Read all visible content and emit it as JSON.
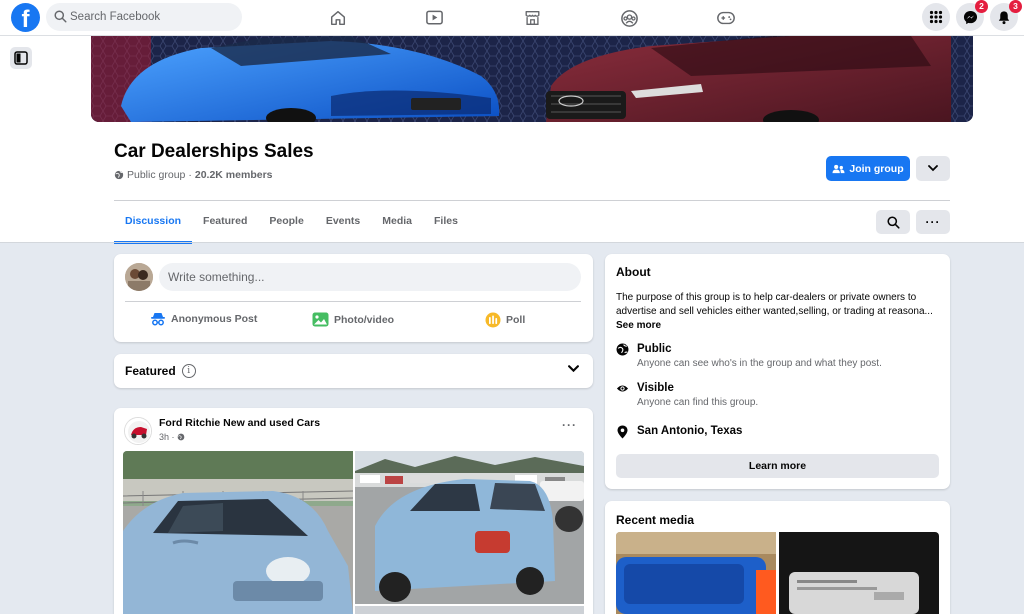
{
  "topbar": {
    "logo": "f",
    "search_placeholder": "Search Facebook",
    "nav_icons": [
      "home-icon",
      "video-icon",
      "marketplace-icon",
      "groups-icon",
      "gaming-icon"
    ],
    "messenger_badge": "2",
    "notifications_badge": "3"
  },
  "group": {
    "title": "Car Dealerships Sales",
    "privacy": "Public group",
    "separator": "·",
    "members": "20.2K members",
    "join_label": "Join group"
  },
  "tabs": [
    {
      "label": "Discussion"
    },
    {
      "label": "Featured"
    },
    {
      "label": "People"
    },
    {
      "label": "Events"
    },
    {
      "label": "Media"
    },
    {
      "label": "Files"
    }
  ],
  "tab_more": "···",
  "composer": {
    "placeholder": "Write something...",
    "anonymous_label": "Anonymous Post",
    "photo_label": "Photo/video",
    "poll_label": "Poll"
  },
  "featured": {
    "label": "Featured",
    "info": "i"
  },
  "post": {
    "author": "Ford Ritchie New and used Cars",
    "time": "3h ·",
    "more": "···"
  },
  "about": {
    "title": "About",
    "description": "The purpose of this group is to help car-dealers or private owners to advertise and sell vehicles either wanted,selling, or trading at reasona...",
    "see_more": "See more",
    "public_title": "Public",
    "public_sub": "Anyone can see who's in the group and what they post.",
    "visible_title": "Visible",
    "visible_sub": "Anyone can find this group.",
    "location": "San Antonio, Texas",
    "learn_more": "Learn more"
  },
  "media": {
    "title": "Recent media"
  },
  "colors": {
    "brand_blue": "#1877f2",
    "badge_red": "#e41e3f",
    "page_bg": "#e4e9f0"
  }
}
